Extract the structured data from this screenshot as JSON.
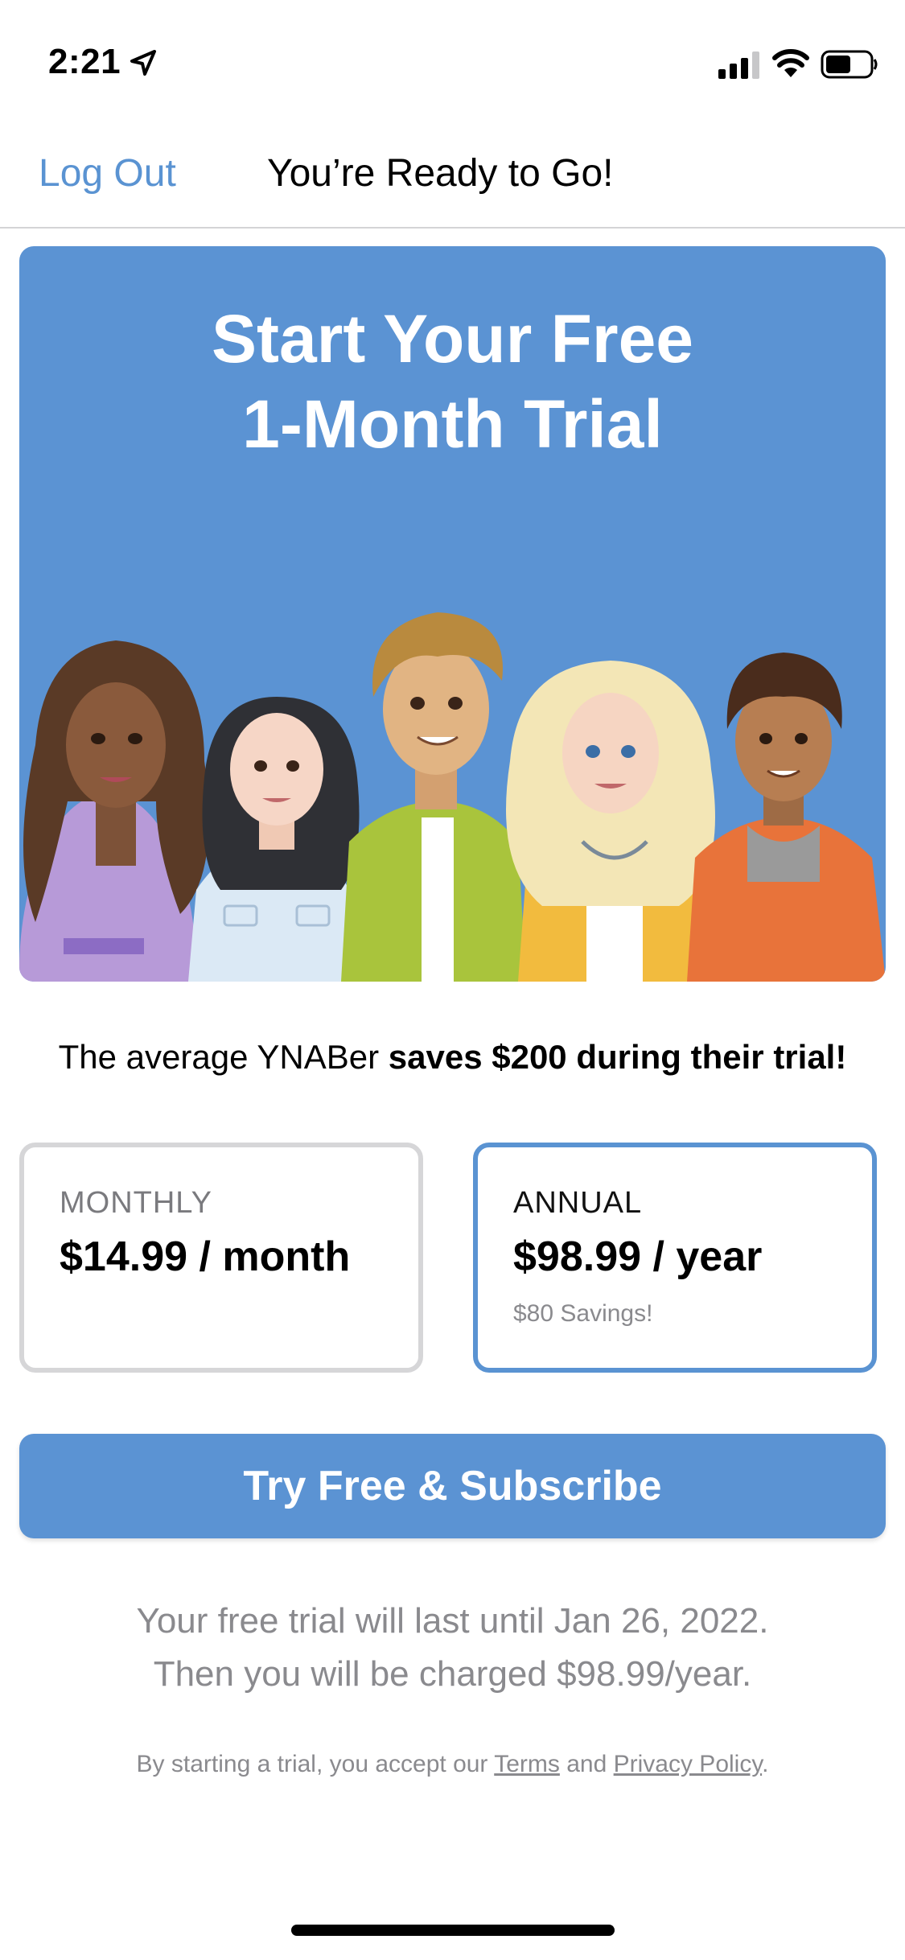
{
  "status": {
    "time": "2:21"
  },
  "nav": {
    "logout_label": "Log Out",
    "title": "You’re Ready to Go!"
  },
  "hero": {
    "title_line1": "Start Your Free",
    "title_line2": "1-Month Trial",
    "background": "#5b93d3"
  },
  "avg": {
    "prefix": "The average YNABer ",
    "bold": "saves $200 during their trial!"
  },
  "plans": [
    {
      "label": "MONTHLY",
      "price": "$14.99 / month",
      "savings": "",
      "selected": false
    },
    {
      "label": "ANNUAL",
      "price": "$98.99 / year",
      "savings": "$80 Savings!",
      "selected": true
    }
  ],
  "cta": {
    "label": "Try Free & Subscribe"
  },
  "trial": {
    "line1": "Your free trial will last until Jan 26, 2022.",
    "line2": "Then you will be charged $98.99/year."
  },
  "legal": {
    "prefix": "By starting a trial, you accept our ",
    "terms": "Terms",
    "and": " and ",
    "privacy": "Privacy Policy",
    "suffix": "."
  },
  "colors": {
    "accent": "#5a93d2",
    "muted": "#8a8a8e"
  },
  "icons": [
    "location-arrow-icon",
    "signal-icon",
    "wifi-icon",
    "battery-icon"
  ]
}
